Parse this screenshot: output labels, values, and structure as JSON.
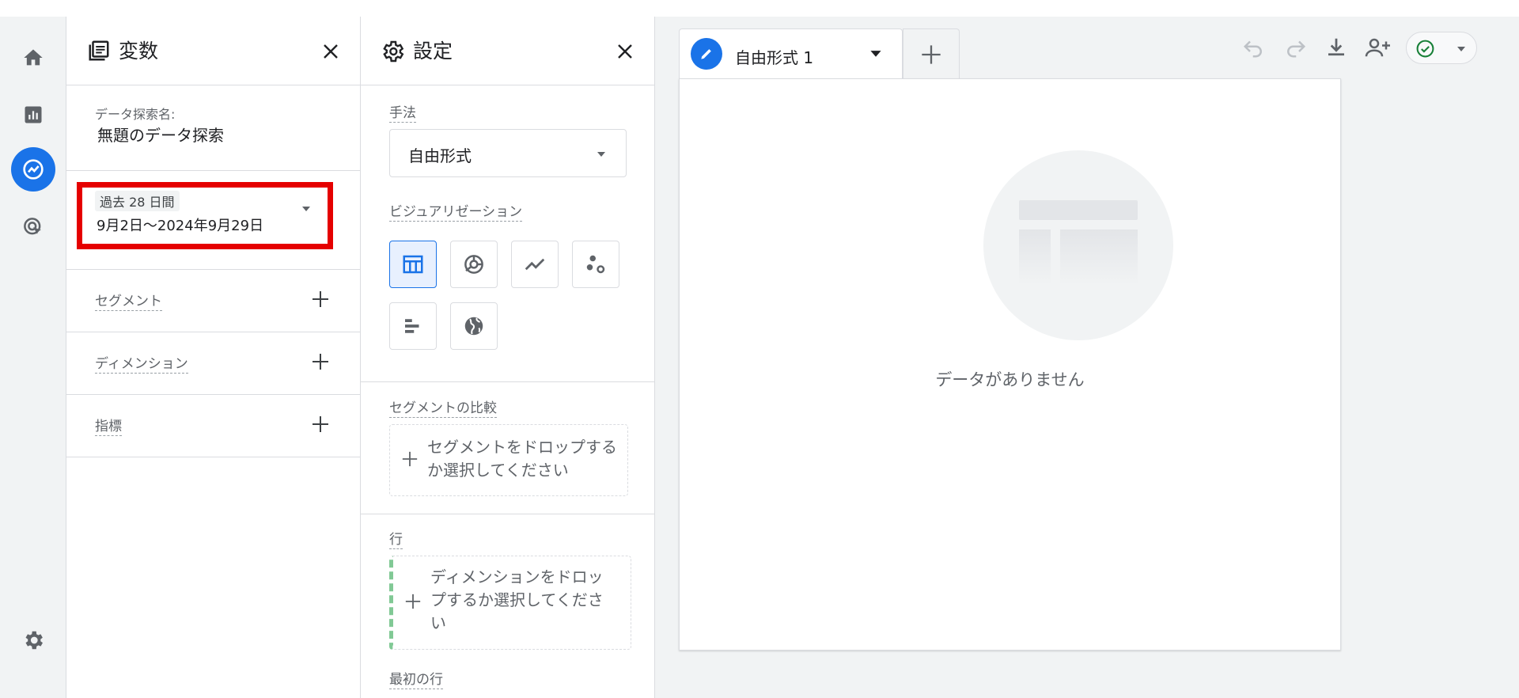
{
  "rail": {
    "items": [
      {
        "icon": "home-icon",
        "active": false
      },
      {
        "icon": "reports-icon",
        "active": false
      },
      {
        "icon": "explore-icon",
        "active": true
      },
      {
        "icon": "advertising-icon",
        "active": false
      }
    ],
    "bottom_icon": "gear-icon"
  },
  "variables": {
    "title": "変数",
    "exploration_name_label": "データ探索名:",
    "exploration_name": "無題のデータ探索",
    "date_range": {
      "chip": "過去 28 日間",
      "range": "9月2日〜2024年9月29日"
    },
    "segments_label": "セグメント",
    "dimensions_label": "ディメンション",
    "metrics_label": "指標"
  },
  "settings": {
    "title": "設定",
    "technique_label": "手法",
    "technique_value": "自由形式",
    "visualization_label": "ビジュアリゼーション",
    "visualizations": [
      "table-icon",
      "donut-chart-icon",
      "line-chart-icon",
      "scatter-plot-icon",
      "bar-chart-icon",
      "geo-map-icon"
    ],
    "selected_visualization": "table-icon",
    "segment_compare_label": "セグメントの比較",
    "segment_drop": "セグメントをドロップするか選択してください",
    "rows_label": "行",
    "rows_drop": "ディメンションをドロップするか選択してください",
    "first_row_label": "最初の行"
  },
  "canvas": {
    "tab_label": "自由形式 1",
    "empty_message": "データがありません"
  },
  "colors": {
    "accent": "#1a73e8",
    "highlight": "#e50000",
    "status_green": "#188038"
  }
}
